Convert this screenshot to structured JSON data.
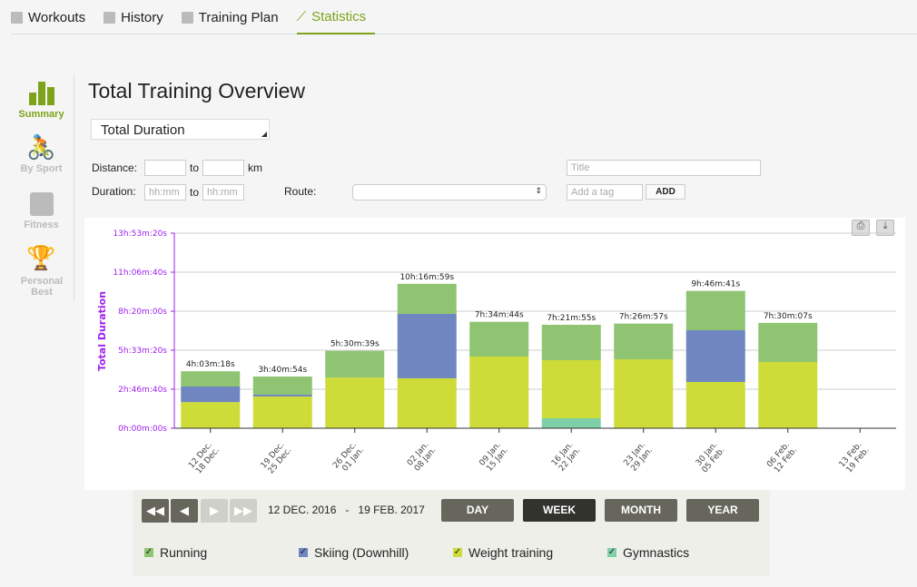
{
  "tabs": [
    {
      "label": "Workouts",
      "icon": "calendar-icon"
    },
    {
      "label": "History",
      "icon": "list-icon"
    },
    {
      "label": "Training Plan",
      "icon": "document-icon"
    },
    {
      "label": "Statistics",
      "icon": "line-chart-icon",
      "active": true
    }
  ],
  "sidebar": [
    {
      "label": "Summary",
      "active": true
    },
    {
      "label": "By Sport"
    },
    {
      "label": "Fitness"
    },
    {
      "label": "Personal Best"
    }
  ],
  "title": "Total Training Overview",
  "metric_select": "Total Duration",
  "filters": {
    "distance_label": "Distance:",
    "to": "to",
    "km": "km",
    "duration_label": "Duration:",
    "duration_placeholder": "hh:mm",
    "route_label": "Route:",
    "title_placeholder": "Title",
    "tag_placeholder": "Add a tag",
    "add": "ADD"
  },
  "chart_data": {
    "type": "bar",
    "stacked": true,
    "ylabel": "Total Duration",
    "ylim_seconds": [
      0,
      50000
    ],
    "yticks": [
      "0h:00m:00s",
      "2h:46m:40s",
      "5h:33m:20s",
      "8h:20m:00s",
      "11h:06m:40s",
      "13h:53m:20s"
    ],
    "grid": true,
    "categories": [
      [
        "12 Dec.",
        "18 Dec."
      ],
      [
        "19 Dec.",
        "25 Dec."
      ],
      [
        "26 Dec.",
        "01 Jan."
      ],
      [
        "02 Jan.",
        "08 Jan."
      ],
      [
        "09 Jan.",
        "15 Jan."
      ],
      [
        "16 Jan.",
        "22 Jan."
      ],
      [
        "23 Jan.",
        "29 Jan."
      ],
      [
        "30 Jan.",
        "05 Feb."
      ],
      [
        "06 Feb.",
        "12 Feb."
      ],
      [
        "13 Feb.",
        "19 Feb."
      ]
    ],
    "totals": [
      "4h:03m:18s",
      "3h:40m:54s",
      "5h:30m:39s",
      "10h:16m:59s",
      "7h:34m:44s",
      "7h:21m:55s",
      "7h:26m:57s",
      "9h:46m:41s",
      "7h:30m:07s",
      ""
    ],
    "series": [
      {
        "name": "Gymnastics",
        "color": "#7fd0a8",
        "values": [
          0,
          0,
          0,
          0,
          0,
          2560,
          0,
          0,
          0,
          0
        ]
      },
      {
        "name": "Weight training",
        "color": "#cddc39",
        "values": [
          6700,
          8140,
          13000,
          12800,
          18370,
          14880,
          17670,
          11860,
          16980,
          0
        ]
      },
      {
        "name": "Skiing (Downhill)",
        "color": "#6f86c0",
        "values": [
          4000,
          460,
          0,
          16500,
          0,
          0,
          0,
          13260,
          0,
          0
        ]
      },
      {
        "name": "Running",
        "color": "#8fc472",
        "values": [
          3898,
          4654,
          6839,
          7719,
          8914,
          9075,
          9147,
          10081,
          10027,
          0
        ]
      }
    ]
  },
  "period": {
    "range_start": "12 DEC. 2016",
    "dash": "-",
    "range_end": "19 FEB. 2017",
    "buttons": [
      "DAY",
      "WEEK",
      "MONTH",
      "YEAR"
    ],
    "active": "WEEK"
  },
  "legend": [
    {
      "label": "Running",
      "color": "#8fc472"
    },
    {
      "label": "Skiing (Downhill)",
      "color": "#6f86c0"
    },
    {
      "label": "Weight training",
      "color": "#cddc39"
    },
    {
      "label": "Gymnastics",
      "color": "#7fd0a8"
    }
  ]
}
